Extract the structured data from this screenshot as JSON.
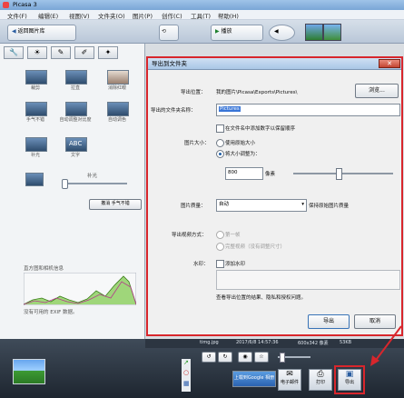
{
  "app": {
    "title": "Picasa 3"
  },
  "menu": [
    "文件(F)",
    "编辑(E)",
    "视图(V)",
    "文件夹(O)",
    "图片(P)",
    "创作(C)",
    "工具(T)",
    "帮助(H)"
  ],
  "toolbar": {
    "import_label": "返回图片库",
    "play_label": "播放"
  },
  "left_panel": {
    "thumbs": [
      {
        "label": "裁剪"
      },
      {
        "label": "拉直"
      },
      {
        "label": "消除红眼"
      },
      {
        "label": "手气不错"
      },
      {
        "label": "自动调整对比度"
      },
      {
        "label": "自动调色"
      },
      {
        "label": "补光"
      },
      {
        "label": "文字"
      }
    ],
    "fill_light_label": "补光",
    "undo_label": "撤消 手气不错",
    "histogram_label": "直方图和相机信息",
    "exif_label": "没有可用的 EXIF 数据。"
  },
  "dialog": {
    "title": "导出到文件夹",
    "export_location_label": "导出位置：",
    "export_location_value": "我的图片\\Picasa\\Exports\\Pictures\\",
    "browse_label": "浏览...",
    "folder_name_label": "导出的文件夹名称：",
    "folder_name_value": "Pictures",
    "add_seq_label": "在文件名中添加数字以保留顺序",
    "image_size_label": "图片大小：",
    "original_size_label": "使用原始大小",
    "resize_label": "将大小调整为：",
    "resize_value": "800",
    "pixels_label": "像素",
    "quality_label": "图片质量：",
    "quality_value": "自动",
    "keep_quality_label": "保持原始图片质量",
    "video_format_label": "导出视频方式：",
    "video_option1": "第一帧",
    "video_option2": "完整视频（没有调整尺寸）",
    "watermark_label": "水印：",
    "add_watermark_label": "添加水印",
    "hint": "查看导出位置的结果、隐私和授权问题。",
    "export_button": "导出",
    "cancel_button": "取消"
  },
  "status_bar": {
    "filename": "timg.jpg",
    "datetime": "2017/6/8 14:57:36",
    "dimensions": "600x342 像素",
    "size": "53KB"
  },
  "tray": {
    "google_label": "上载到Google 相册",
    "email_label": "电子邮件",
    "print_label": "打印",
    "export_label": "导出"
  }
}
